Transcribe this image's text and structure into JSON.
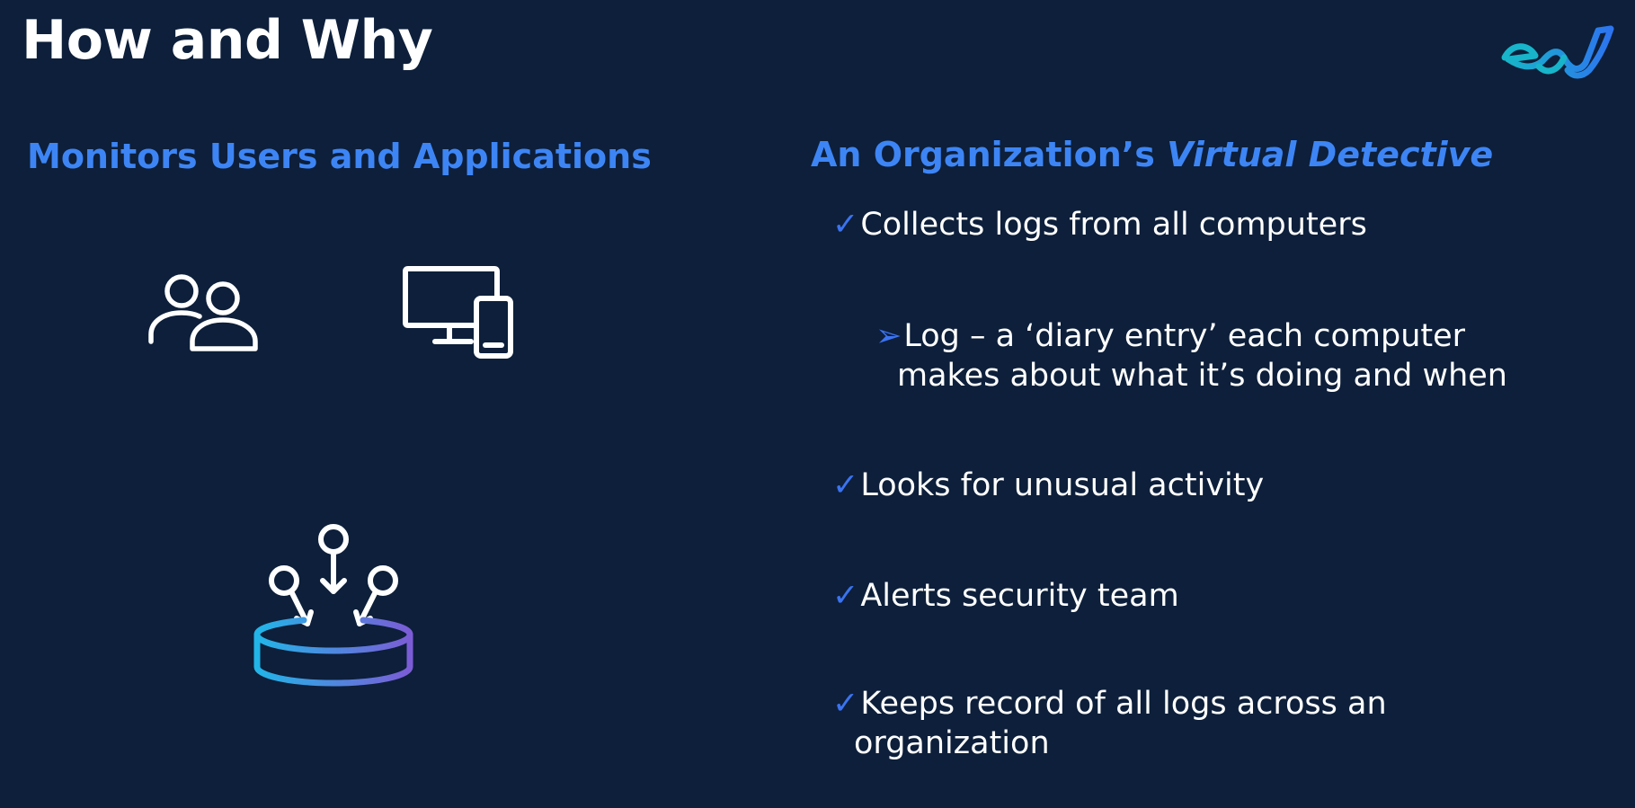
{
  "slide": {
    "title": "How and Why"
  },
  "left": {
    "heading": "Monitors Users and Applications",
    "icons": [
      "users-icon",
      "devices-icon",
      "data-ingest-icon"
    ]
  },
  "right": {
    "heading_prefix": "An Organization’s ",
    "heading_emphasis": "Virtual Detective",
    "bullets": [
      {
        "marker": "✓",
        "text": "Collects logs from all computers"
      },
      {
        "marker": "➢",
        "text": "Log – a ‘diary entry’ each computer",
        "continuation": "makes about what it’s doing and when"
      },
      {
        "marker": "✓",
        "text": "Looks for unusual activity"
      },
      {
        "marker": "✓",
        "text": "Alerts security team"
      },
      {
        "marker": "✓",
        "text": "Keeps record of all logs across an",
        "continuation": "organization"
      }
    ]
  },
  "colors": {
    "background": "#0d1f3a",
    "heading_accent": "#3d85f5",
    "bullet_marker": "#3b73f0",
    "logo_teal": "#18b4c9",
    "logo_blue": "#2d74f0",
    "gradient_cyan": "#22b5e8",
    "gradient_purple": "#7b5cd6"
  }
}
